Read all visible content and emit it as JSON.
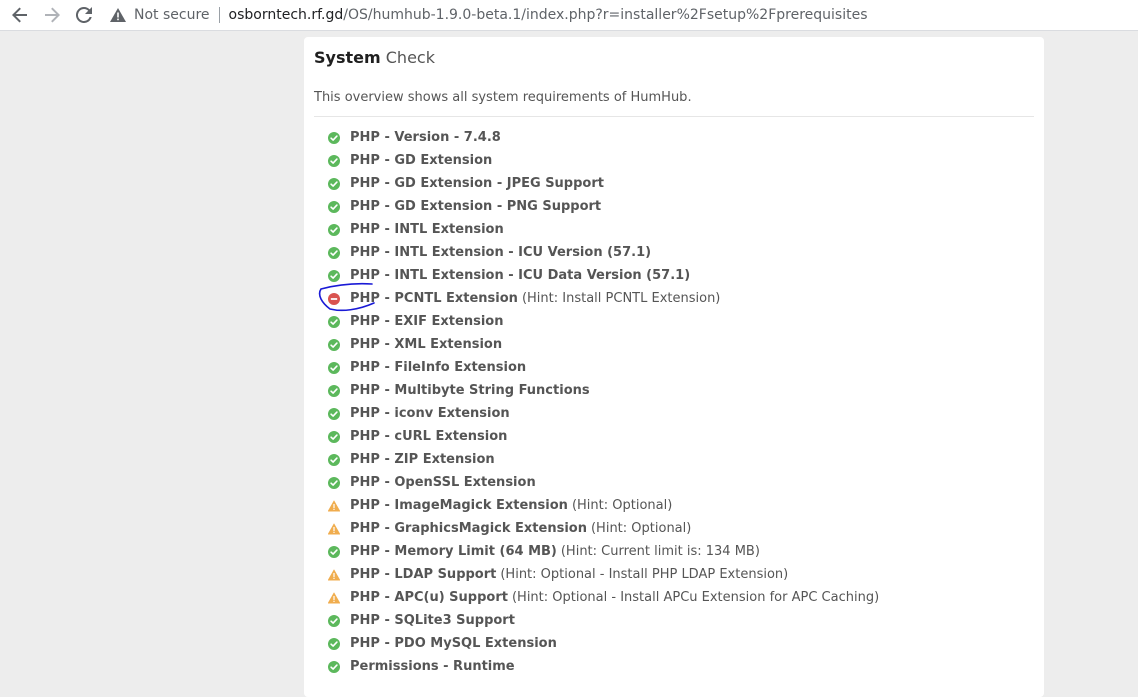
{
  "browser": {
    "security_label": "Not secure",
    "url_host": "osborntech.rf.gd",
    "url_path": "/OS/humhub-1.9.0-beta.1/index.php?r=installer%2Fsetup%2Fprerequisites"
  },
  "panel": {
    "title_strong": "System",
    "title_light": "Check",
    "intro": "This overview shows all system requirements of HumHub."
  },
  "colors": {
    "ok": "#5cb85c",
    "error": "#d9534f",
    "warning": "#f0ad4e",
    "annotation": "#1a1ad6"
  },
  "checks": [
    {
      "title": "PHP - Version - 7.4.8",
      "hint": "",
      "status": "ok",
      "icon": "check-circle-icon"
    },
    {
      "title": "PHP - GD Extension",
      "hint": "",
      "status": "ok",
      "icon": "check-circle-icon"
    },
    {
      "title": "PHP - GD Extension - JPEG Support",
      "hint": "",
      "status": "ok",
      "icon": "check-circle-icon"
    },
    {
      "title": "PHP - GD Extension - PNG Support",
      "hint": "",
      "status": "ok",
      "icon": "check-circle-icon"
    },
    {
      "title": "PHP - INTL Extension",
      "hint": "",
      "status": "ok",
      "icon": "check-circle-icon"
    },
    {
      "title": "PHP - INTL Extension - ICU Version (57.1)",
      "hint": "",
      "status": "ok",
      "icon": "check-circle-icon"
    },
    {
      "title": "PHP - INTL Extension - ICU Data Version (57.1)",
      "hint": "",
      "status": "ok",
      "icon": "check-circle-icon"
    },
    {
      "title": "PHP - PCNTL Extension",
      "hint": "(Hint: Install PCNTL Extension)",
      "status": "error",
      "icon": "minus-circle-icon"
    },
    {
      "title": "PHP - EXIF Extension",
      "hint": "",
      "status": "ok",
      "icon": "check-circle-icon"
    },
    {
      "title": "PHP - XML Extension",
      "hint": "",
      "status": "ok",
      "icon": "check-circle-icon"
    },
    {
      "title": "PHP - FileInfo Extension",
      "hint": "",
      "status": "ok",
      "icon": "check-circle-icon"
    },
    {
      "title": "PHP - Multibyte String Functions",
      "hint": "",
      "status": "ok",
      "icon": "check-circle-icon"
    },
    {
      "title": "PHP - iconv Extension",
      "hint": "",
      "status": "ok",
      "icon": "check-circle-icon"
    },
    {
      "title": "PHP - cURL Extension",
      "hint": "",
      "status": "ok",
      "icon": "check-circle-icon"
    },
    {
      "title": "PHP - ZIP Extension",
      "hint": "",
      "status": "ok",
      "icon": "check-circle-icon"
    },
    {
      "title": "PHP - OpenSSL Extension",
      "hint": "",
      "status": "ok",
      "icon": "check-circle-icon"
    },
    {
      "title": "PHP - ImageMagick Extension",
      "hint": "(Hint: Optional)",
      "status": "warning",
      "icon": "warning-triangle-icon"
    },
    {
      "title": "PHP - GraphicsMagick Extension",
      "hint": "(Hint: Optional)",
      "status": "warning",
      "icon": "warning-triangle-icon"
    },
    {
      "title": "PHP - Memory Limit (64 MB)",
      "hint": "(Hint: Current limit is: 134 MB)",
      "status": "ok",
      "icon": "check-circle-icon"
    },
    {
      "title": "PHP - LDAP Support",
      "hint": "(Hint: Optional - Install PHP LDAP Extension)",
      "status": "warning",
      "icon": "warning-triangle-icon"
    },
    {
      "title": "PHP - APC(u) Support",
      "hint": "(Hint: Optional - Install APCu Extension for APC Caching)",
      "status": "warning",
      "icon": "warning-triangle-icon"
    },
    {
      "title": "PHP - SQLite3 Support",
      "hint": "",
      "status": "ok",
      "icon": "check-circle-icon"
    },
    {
      "title": "PHP - PDO MySQL Extension",
      "hint": "",
      "status": "ok",
      "icon": "check-circle-icon"
    },
    {
      "title": "Permissions - Runtime",
      "hint": "",
      "status": "ok",
      "icon": "check-circle-icon"
    }
  ]
}
